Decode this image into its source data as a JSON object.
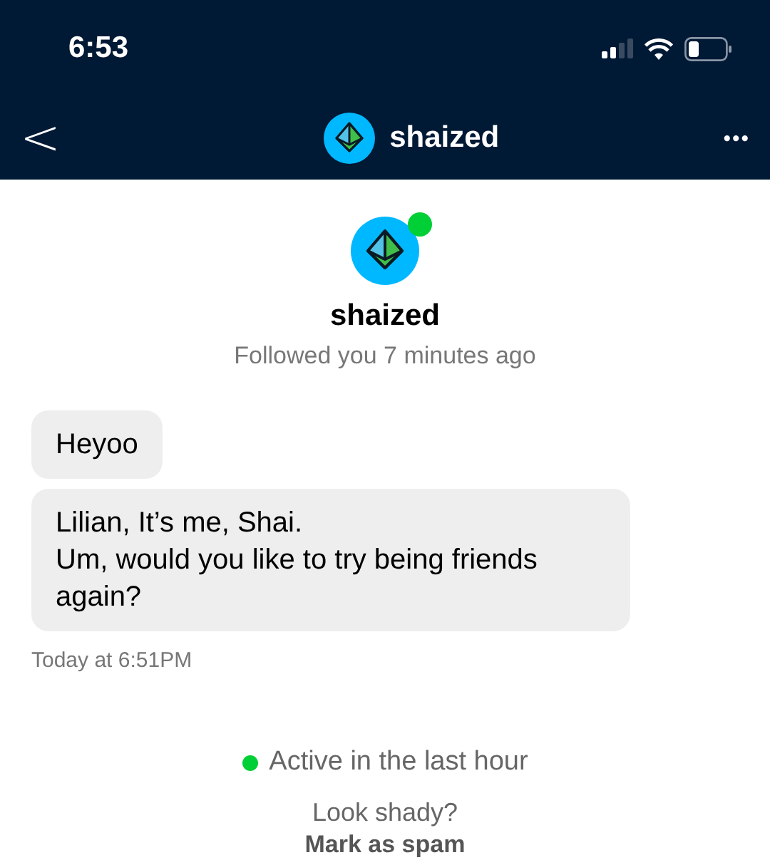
{
  "status_bar": {
    "time": "6:53"
  },
  "header": {
    "back": "<",
    "title": "shaized",
    "more": "•••"
  },
  "profile": {
    "name": "shaized",
    "online": true,
    "subtitle": "Followed you 7 minutes ago"
  },
  "messages": [
    {
      "text": "Heyoo"
    },
    {
      "text": "Lilian, It’s me, Shai.\nUm, would you like to try being friends again?"
    }
  ],
  "timestamp": "Today at 6:51PM",
  "activity": "Active in the last hour",
  "spam": {
    "prompt": "Look shady?",
    "action": "Mark as spam"
  }
}
